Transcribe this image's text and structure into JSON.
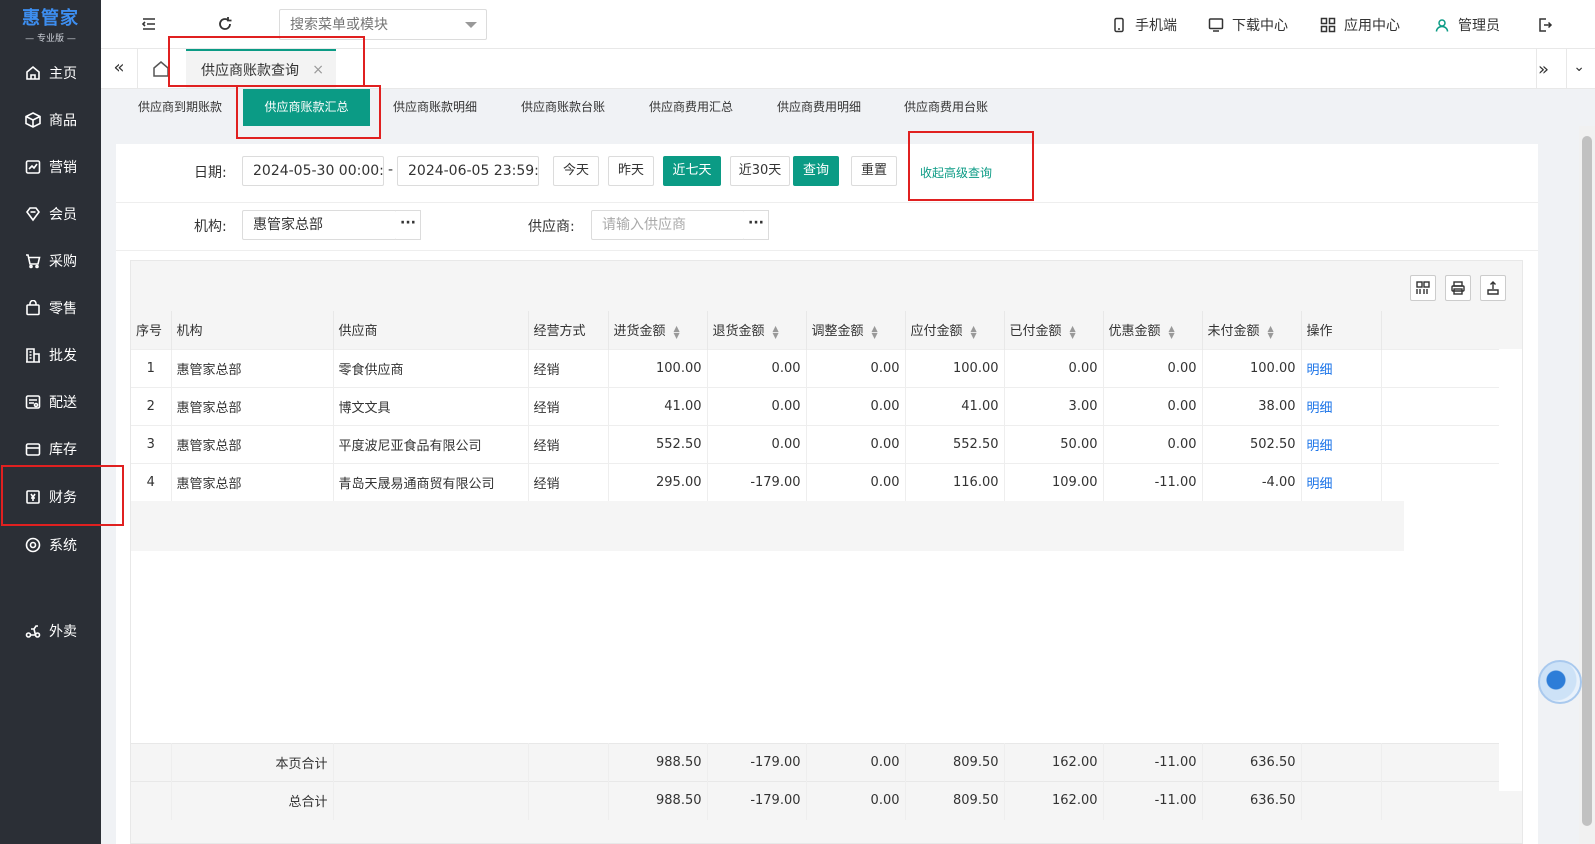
{
  "app": {
    "brand": "惠管家",
    "edition": "— 专业版 —"
  },
  "sidebar": {
    "items": [
      {
        "label": "主页",
        "icon": "home-icon"
      },
      {
        "label": "商品",
        "icon": "box-icon"
      },
      {
        "label": "营销",
        "icon": "chart-icon"
      },
      {
        "label": "会员",
        "icon": "member-icon"
      },
      {
        "label": "采购",
        "icon": "purchase-icon"
      },
      {
        "label": "零售",
        "icon": "bag-icon"
      },
      {
        "label": "批发",
        "icon": "building-icon"
      },
      {
        "label": "配送",
        "icon": "delivery-icon"
      },
      {
        "label": "库存",
        "icon": "inventory-icon"
      },
      {
        "label": "财务",
        "icon": "finance-icon"
      },
      {
        "label": "系统",
        "icon": "settings-icon"
      },
      {
        "label": "外卖",
        "icon": "takeout-icon"
      }
    ]
  },
  "topbar": {
    "search_placeholder": "搜索菜单或模块",
    "mobile": "手机端",
    "download": "下载中心",
    "apps": "应用中心",
    "user": "管理员"
  },
  "tabs": {
    "open_tab": "供应商账款查询",
    "close": "×"
  },
  "subtabs": [
    "供应商到期账款",
    "供应商账款汇总",
    "供应商账款明细",
    "供应商账款台账",
    "供应商费用汇总",
    "供应商费用明细",
    "供应商费用台账"
  ],
  "filters": {
    "date_label": "日期:",
    "date_start": "2024-05-30 00:00:00",
    "date_sep": "-",
    "date_end": "2024-06-05 23:59:59",
    "btn_today": "今天",
    "btn_yesterday": "昨天",
    "btn_7days": "近七天",
    "btn_30days": "近30天",
    "btn_query": "查询",
    "btn_reset": "重置",
    "advanced": "收起高级查询",
    "org_label": "机构:",
    "org_value": "惠管家总部",
    "supplier_label": "供应商:",
    "supplier_placeholder": "请输入供应商",
    "dots": "···"
  },
  "table": {
    "headers": [
      "序号",
      "机构",
      "供应商",
      "经营方式",
      "进货金额",
      "退货金额",
      "调整金额",
      "应付金额",
      "已付金额",
      "优惠金额",
      "未付金额",
      "操作"
    ],
    "rows": [
      [
        "1",
        "惠管家总部",
        "零食供应商",
        "经销",
        "100.00",
        "0.00",
        "0.00",
        "100.00",
        "0.00",
        "0.00",
        "100.00",
        "明细"
      ],
      [
        "2",
        "惠管家总部",
        "博文文具",
        "经销",
        "41.00",
        "0.00",
        "0.00",
        "41.00",
        "3.00",
        "0.00",
        "38.00",
        "明细"
      ],
      [
        "3",
        "惠管家总部",
        "平度波尼亚食品有限公司",
        "经销",
        "552.50",
        "0.00",
        "0.00",
        "552.50",
        "50.00",
        "0.00",
        "502.50",
        "明细"
      ],
      [
        "4",
        "惠管家总部",
        "青岛天晟易通商贸有限公司",
        "经销",
        "295.00",
        "-179.00",
        "0.00",
        "116.00",
        "109.00",
        "-11.00",
        "-4.00",
        "明细"
      ]
    ],
    "page_total": {
      "label": "本页合计",
      "values": [
        "988.50",
        "-179.00",
        "0.00",
        "809.50",
        "162.00",
        "-11.00",
        "636.50"
      ]
    },
    "grand_total": {
      "label": "总合计",
      "values": [
        "988.50",
        "-179.00",
        "0.00",
        "809.50",
        "162.00",
        "-11.00",
        "636.50"
      ]
    }
  },
  "colors": {
    "sidebar_bg": "#2b2f36",
    "accent": "#0b9b85",
    "highlight": "#e02020",
    "link": "#1a73e8"
  }
}
